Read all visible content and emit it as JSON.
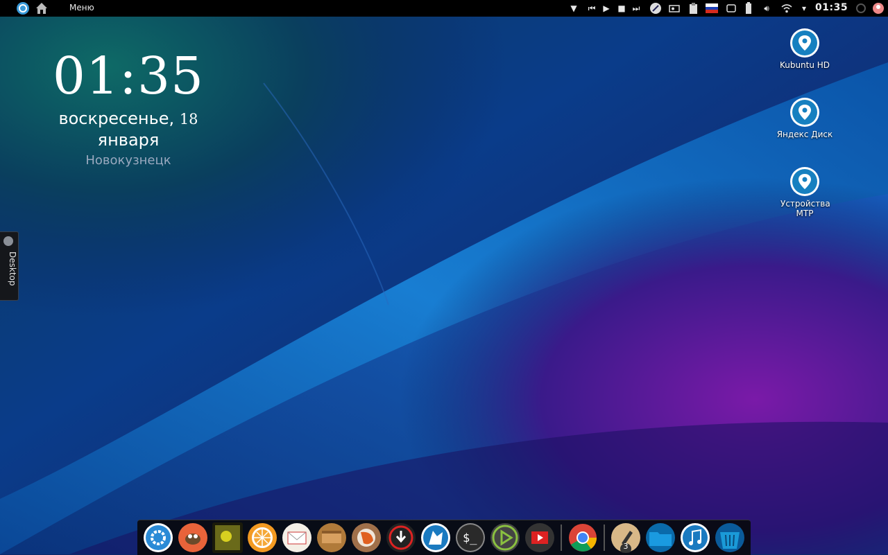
{
  "topbar": {
    "menu_label": "Меню",
    "clock": "01:35",
    "left_icons": [
      "kde-logo-icon",
      "home-icon"
    ],
    "tray_icons": [
      "triangle-down-icon",
      "previous-track-icon",
      "play-icon",
      "stop-icon",
      "next-track-icon",
      "rocket-launcher-icon",
      "disk-drive-icon",
      "clipboard-icon",
      "russian-flag-icon",
      "window-icon",
      "battery-icon",
      "volume-icon",
      "wifi-icon",
      "arrow-down-icon",
      "power-icon",
      "user-avatar-icon"
    ]
  },
  "clock_widget": {
    "time": "01:35",
    "weekday": "воскресенье,",
    "day": "18",
    "month": "января",
    "city": "Новокузнецк"
  },
  "desktop_icons": [
    {
      "label": "Kubuntu HD",
      "icon": "location-pin-icon"
    },
    {
      "label": "Яндекс Диск",
      "icon": "location-pin-icon"
    },
    {
      "label": "Устройства MTP",
      "icon": "location-pin-icon"
    }
  ],
  "side_panel": {
    "label": "Desktop"
  },
  "dock": {
    "items": [
      {
        "name": "kde-menu",
        "icon": "kde-gear-icon"
      },
      {
        "name": "gimp",
        "icon": "gimp-icon"
      },
      {
        "name": "photo-viewer",
        "icon": "photo-icon"
      },
      {
        "name": "orange-app",
        "icon": "orange-slice-icon"
      },
      {
        "name": "mail",
        "icon": "mail-envelope-icon"
      },
      {
        "name": "files",
        "icon": "package-box-icon"
      },
      {
        "name": "firefox",
        "icon": "firefox-icon"
      },
      {
        "name": "downloader",
        "icon": "download-icon"
      },
      {
        "name": "kdenlive",
        "icon": "wolf-icon"
      },
      {
        "name": "terminal",
        "icon": "terminal-icon"
      },
      {
        "name": "media-player",
        "icon": "play-triangle-icon"
      },
      {
        "name": "video-app",
        "icon": "video-icon"
      },
      {
        "name": "chrome",
        "icon": "chrome-icon"
      },
      {
        "name": "pencil-app",
        "icon": "pencil-icon",
        "badge": "3"
      },
      {
        "name": "folder",
        "icon": "folder-icon"
      },
      {
        "name": "music",
        "icon": "music-note-icon"
      },
      {
        "name": "trash",
        "icon": "trash-icon"
      }
    ]
  }
}
